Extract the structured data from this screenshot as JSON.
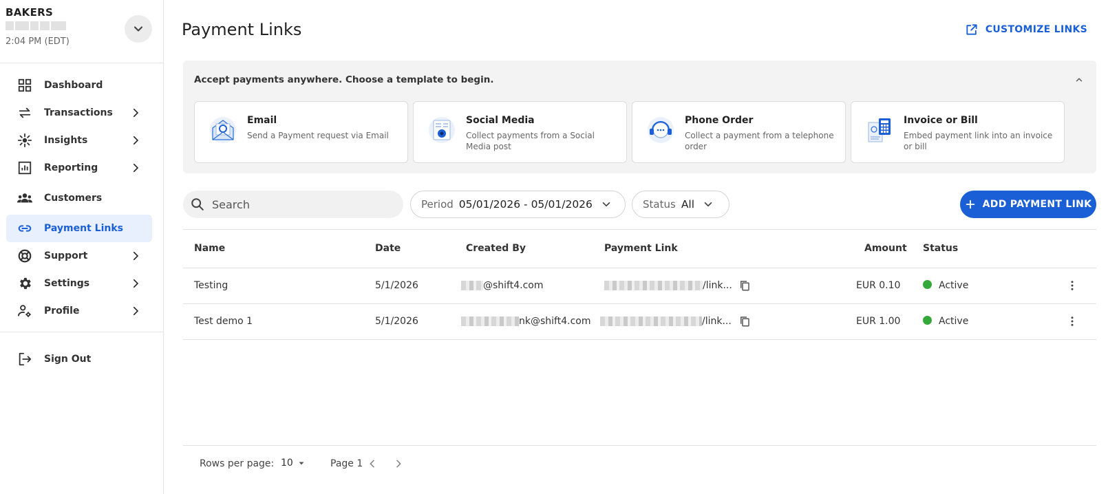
{
  "account": {
    "name": "BAKERS",
    "time": "2:04 PM (EDT)"
  },
  "sidebar": {
    "items": [
      {
        "label": "Dashboard",
        "icon": "dashboard-icon"
      },
      {
        "label": "Transactions",
        "icon": "transfer-arrows-icon"
      },
      {
        "label": "Insights",
        "icon": "insights-icon"
      },
      {
        "label": "Reporting",
        "icon": "bar-chart-icon"
      },
      {
        "label": "Customers",
        "icon": "group-icon"
      },
      {
        "label": "Payment Links",
        "icon": "link-icon"
      },
      {
        "label": "Support",
        "icon": "lifebuoy-icon"
      },
      {
        "label": "Settings",
        "icon": "gear-icon"
      },
      {
        "label": "Profile",
        "icon": "user-settings-icon"
      }
    ],
    "signout": "Sign Out"
  },
  "page": {
    "title": "Payment Links",
    "customize": "CUSTOMIZE LINKS"
  },
  "templates": {
    "heading": "Accept payments anywhere. Choose a template to begin.",
    "cards": [
      {
        "title": "Email",
        "desc": "Send a Payment request via Email"
      },
      {
        "title": "Social Media",
        "desc": "Collect payments from a Social Media post"
      },
      {
        "title": "Phone Order",
        "desc": "Collect a payment from a telephone order"
      },
      {
        "title": "Invoice or Bill",
        "desc": "Embed payment link into an invoice or bill"
      }
    ]
  },
  "toolbar": {
    "search_placeholder": "Search",
    "period_label": "Period",
    "period_value": "05/01/2026 - 05/01/2026",
    "status_label": "Status",
    "status_value": "All",
    "add_label": "ADD PAYMENT LINK"
  },
  "table": {
    "headers": {
      "name": "Name",
      "date": "Date",
      "created_by": "Created By",
      "link": "Payment Link",
      "amount": "Amount",
      "status": "Status"
    },
    "rows": [
      {
        "name": "Testing",
        "date": "5/1/2026",
        "created_by": "@shift4.com",
        "link": "/link...",
        "amount": "EUR 0.10",
        "status": "Active"
      },
      {
        "name": "Test demo 1",
        "date": "5/1/2026",
        "created_by": "nk@shift4.com",
        "link": "/link...",
        "amount": "EUR 1.00",
        "status": "Active"
      }
    ]
  },
  "pagination": {
    "rows_label": "Rows per page:",
    "rows_value": "10",
    "page_label": "Page 1"
  },
  "colors": {
    "accent": "#1a5fd6",
    "active_bg": "#e8f0fd",
    "status_active": "#34a83a"
  }
}
